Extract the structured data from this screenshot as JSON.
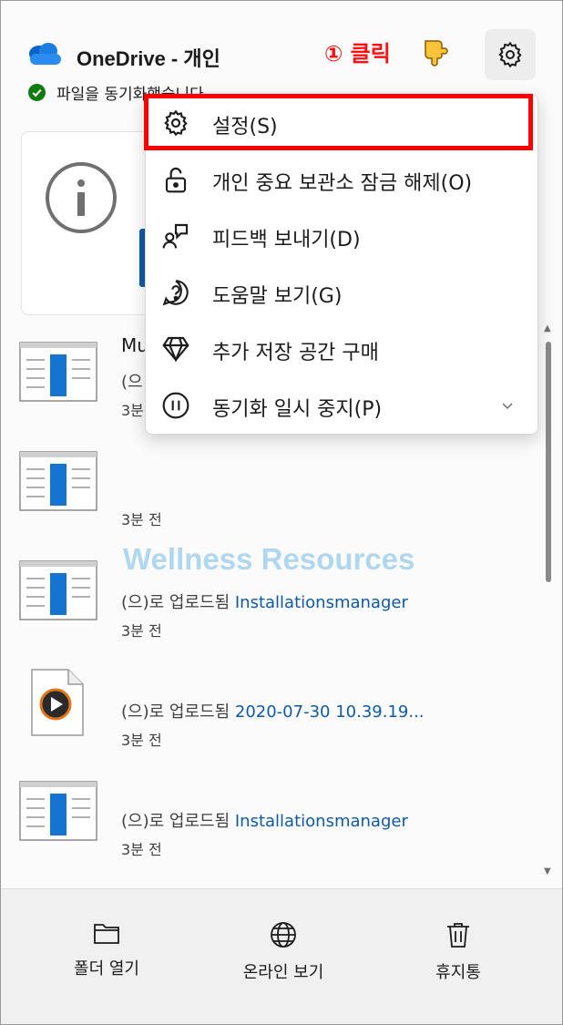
{
  "header": {
    "title": "OneDrive - 개인",
    "annotation": "① 클릭",
    "status": "파일을 동기화했습니다"
  },
  "menu": {
    "items": [
      {
        "label": "설정(S)",
        "icon": "gear-icon"
      },
      {
        "label": "개인 중요 보관소 잠금 해제(O)",
        "icon": "unlock-icon"
      },
      {
        "label": "피드백 보내기(D)",
        "icon": "feedback-icon"
      },
      {
        "label": "도움말 보기(G)",
        "icon": "help-icon"
      },
      {
        "label": "추가 저장 공간 구매",
        "icon": "diamond-icon"
      },
      {
        "label": "동기화 일시 중지(P)",
        "icon": "pause-icon"
      }
    ]
  },
  "files": [
    {
      "name_fragment": "Mu",
      "action_fragment": "(으",
      "time_fragment": "3분"
    },
    {
      "time": "3분 전"
    },
    {
      "action": "(으)로 업로드됨",
      "target": "Installationsmanager",
      "time": "3분 전"
    },
    {
      "action": "(으)로 업로드됨",
      "target": "2020-07-30 10.39.19...",
      "time": "3분 전"
    },
    {
      "action": "(으)로 업로드됨",
      "target": "Installationsmanager",
      "time": "3분 전"
    }
  ],
  "watermark": "Wellness Resources",
  "bottom_bar": {
    "open_folder": "폴더 열기",
    "view_online": "온라인 보기",
    "recycle_bin": "휴지통"
  },
  "colors": {
    "accent": "#0f5aa8",
    "annotation": "#ff0000",
    "status_ok": "#107c10"
  }
}
